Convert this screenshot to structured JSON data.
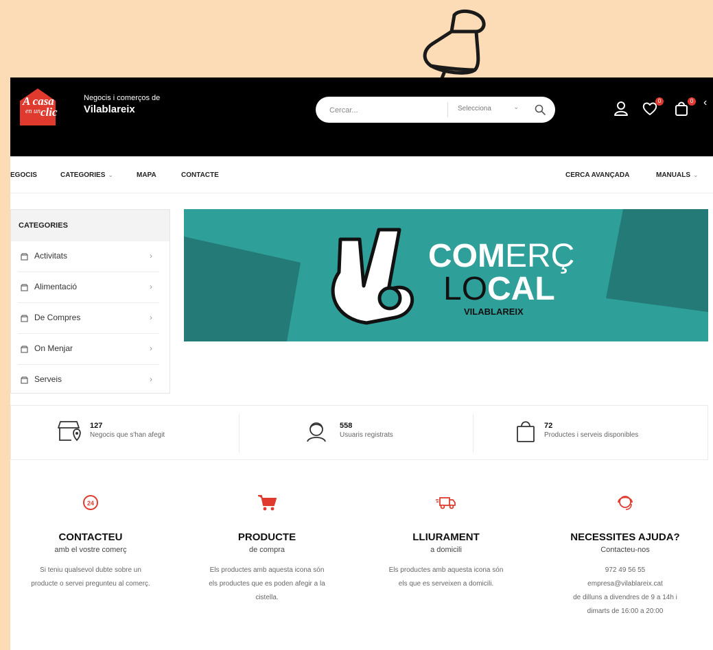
{
  "header": {
    "logo_text": [
      "A casa",
      "en un",
      "clic"
    ],
    "tagline_small": "Negocis i comerços de",
    "tagline_big": "Vilablareix",
    "search_placeholder": "Cercar...",
    "select_label": "Selecciona",
    "wishlist_count": "0",
    "cart_count": "0"
  },
  "nav": {
    "items": [
      "EGOCIS",
      "CATEGORIES",
      "MAPA",
      "CONTACTE"
    ],
    "right_items": [
      "CERCA AVANÇADA",
      "MANUALS"
    ]
  },
  "categories": {
    "title": "CATEGORIES",
    "items": [
      "Activitats",
      "Alimentació",
      "De Compres",
      "On Menjar",
      "Serveis"
    ]
  },
  "banner": {
    "line1_bold": "COM",
    "line1_light": "ERÇ",
    "line2_light": "LO",
    "line2_bold": "CAL",
    "line3": "VILABLAREIX"
  },
  "stats": [
    {
      "value": "127",
      "label": "Negocis que s'han afegit"
    },
    {
      "value": "558",
      "label": "Usuaris registrats"
    },
    {
      "value": "72",
      "label": "Productes i serveis disponibles"
    }
  ],
  "features": [
    {
      "title": "CONTACTEU",
      "subtitle": "amb el vostre comerç",
      "lines": [
        "Si teniu qualsevol dubte sobre un",
        "producte o servei pregunteu al comerç."
      ]
    },
    {
      "title": "PRODUCTE",
      "subtitle": "de compra",
      "lines": [
        "Els productes amb aquesta icona són",
        "els productes que es poden afegir a la",
        "cistella."
      ]
    },
    {
      "title": "LLIURAMENT",
      "subtitle": "a domicili",
      "lines": [
        "Els productes amb aquesta icona són",
        "els que es serveixen a domicili."
      ]
    },
    {
      "title": "NECESSITES AJUDA?",
      "subtitle": "Contacteu-nos",
      "lines": [
        "972 49 56 55",
        "empresa@vilablareix.cat",
        "de dilluns a divendres de 9 a 14h i",
        "dimarts de 16:00 a 20:00"
      ]
    }
  ],
  "icons": {
    "accent": "#e03a2e",
    "banner_teal": "#2f9f99"
  }
}
